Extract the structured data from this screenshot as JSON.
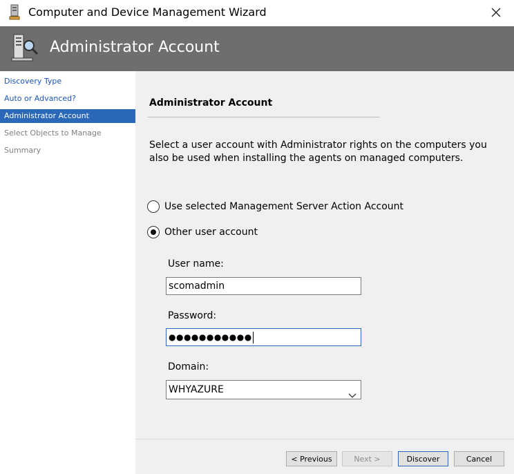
{
  "window": {
    "title": "Computer and Device Management Wizard",
    "close_icon": "close-icon"
  },
  "banner": {
    "title": "Administrator Account",
    "icon": "server-magnifier-icon"
  },
  "nav": {
    "items": [
      {
        "label": "Discovery Type",
        "state": "link"
      },
      {
        "label": "Auto or Advanced?",
        "state": "link"
      },
      {
        "label": "Administrator Account",
        "state": "active"
      },
      {
        "label": "Select Objects to Manage",
        "state": "disabled"
      },
      {
        "label": "Summary",
        "state": "disabled"
      }
    ]
  },
  "main": {
    "section_title": "Administrator Account",
    "description_line1": "Select a user account with Administrator rights on the computers you",
    "description_line2": "also be used when installing the agents on managed computers.",
    "radio_options": [
      {
        "label": "Use selected Management Server Action Account",
        "checked": false
      },
      {
        "label": "Other user account",
        "checked": true
      }
    ],
    "username": {
      "label": "User name:",
      "value": "scomadmin"
    },
    "password": {
      "label": "Password:",
      "masked_value": "●●●●●●●●●●●"
    },
    "domain": {
      "label": "Domain:",
      "value": "WHYAZURE"
    }
  },
  "footer": {
    "previous_label": "< Previous",
    "next_label": "Next >",
    "discover_label": "Discover",
    "cancel_label": "Cancel"
  },
  "colors": {
    "banner": "#6e6e6e",
    "nav_active": "#2b68b8",
    "nav_link": "#1a56b8",
    "content_bg": "#f0f0f0"
  }
}
